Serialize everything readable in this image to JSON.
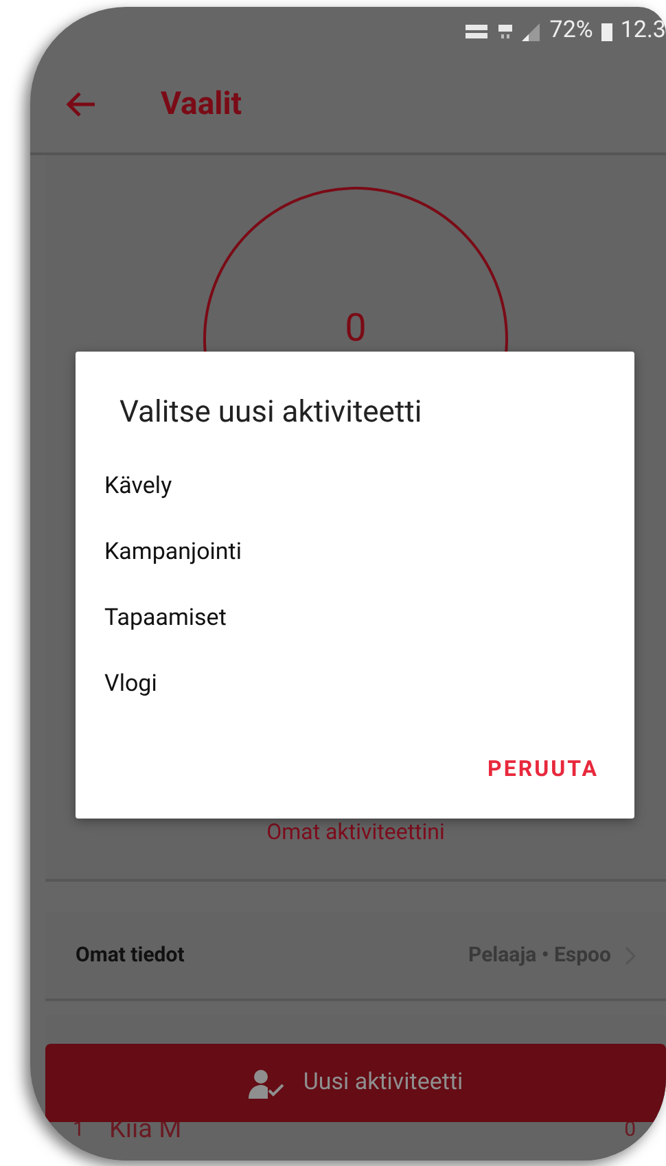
{
  "status_bar": {
    "battery": "72%",
    "time": "12.3"
  },
  "app_bar": {
    "title": "Vaalit"
  },
  "counter": {
    "value": "0"
  },
  "dialog": {
    "title": "Valitse uusi aktiviteetti",
    "options": [
      "Kävely",
      "Kampanjointi",
      "Tapaamiset",
      "Vlogi"
    ],
    "cancel": "PERUUTA"
  },
  "my_activities_link": "Omat aktiviteettini",
  "profile_row": {
    "label": "Omat tiedot",
    "value": "Pelaaja • Espoo"
  },
  "new_activity_button": "Uusi aktiviteetti",
  "leaderboard": [
    {
      "rank": "1",
      "name": "Kiia M",
      "score": "0"
    }
  ]
}
